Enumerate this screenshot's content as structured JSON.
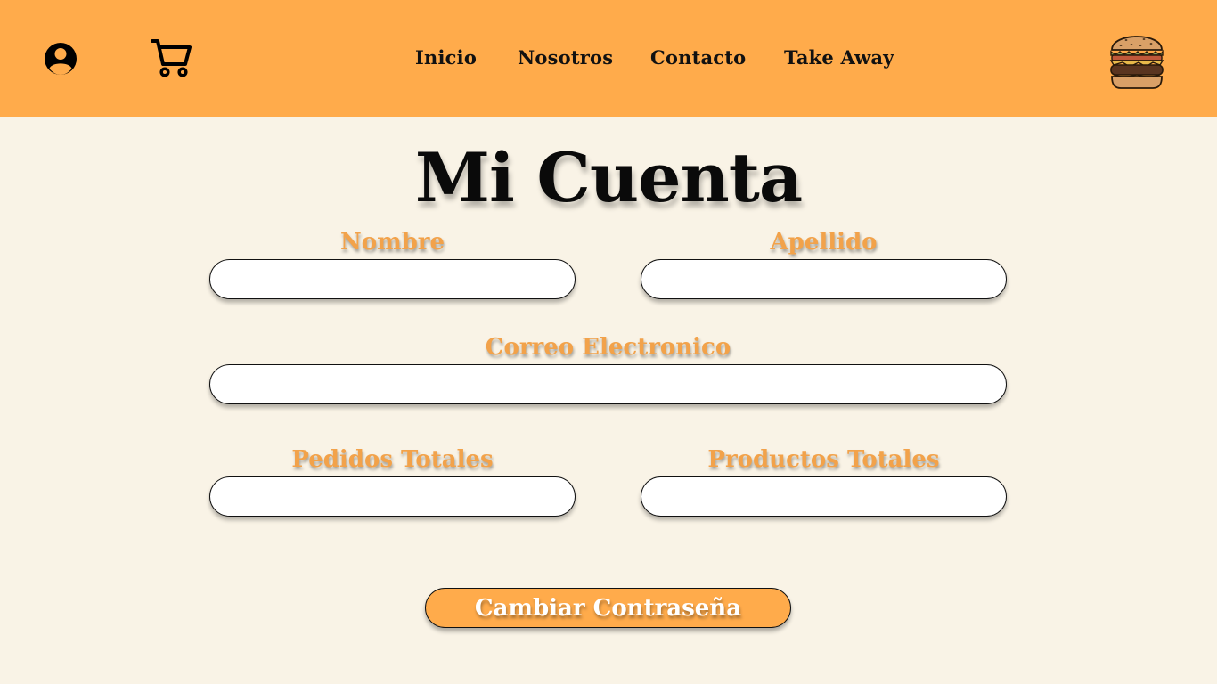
{
  "header": {
    "background_color": "#ffab4b",
    "icons": {
      "user": "user-circle-icon",
      "cart": "shopping-cart-icon",
      "logo": "burger-logo-icon"
    },
    "nav": [
      {
        "label": "Inicio"
      },
      {
        "label": "Nosotros"
      },
      {
        "label": "Contacto"
      },
      {
        "label": "Take Away"
      }
    ]
  },
  "main": {
    "title": "Mi Cuenta",
    "fields": {
      "nombre": {
        "label": "Nombre",
        "value": ""
      },
      "apellido": {
        "label": "Apellido",
        "value": ""
      },
      "correo": {
        "label": "Correo Electronico",
        "value": ""
      },
      "pedidos": {
        "label": "Pedidos Totales",
        "value": ""
      },
      "productos": {
        "label": "Productos Totales",
        "value": ""
      }
    },
    "change_password_label": "Cambiar Contraseña"
  },
  "colors": {
    "accent": "#ffab4b",
    "label_orange": "#f2a24a",
    "page_background": "#f9f3e6"
  }
}
